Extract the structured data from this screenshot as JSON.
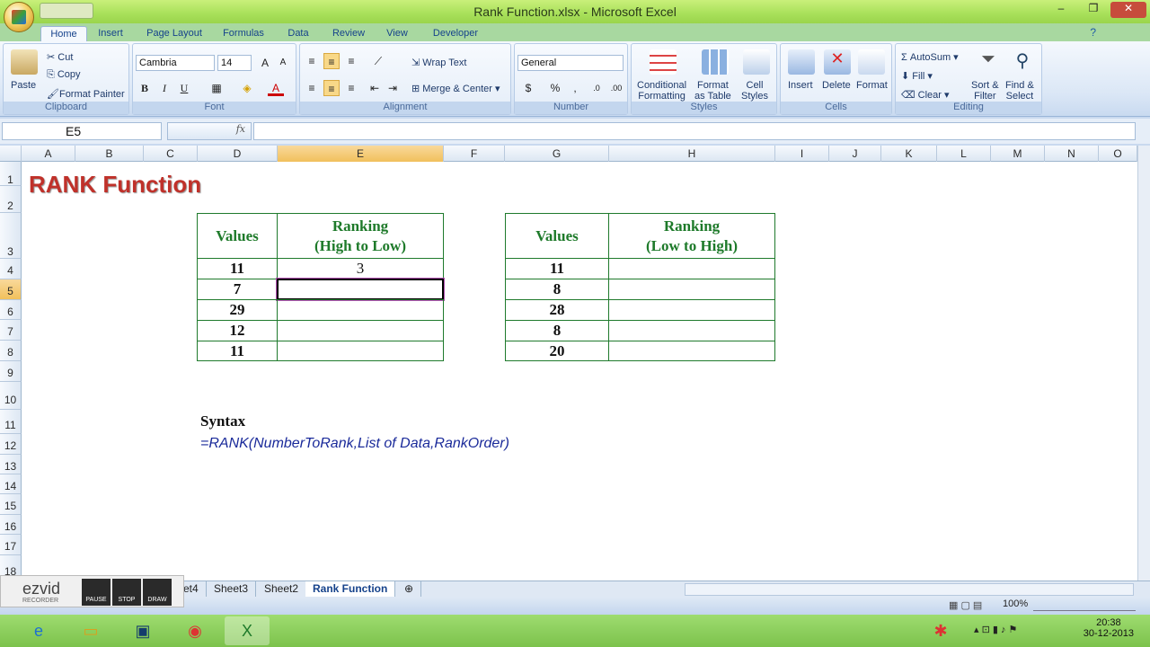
{
  "window": {
    "title": "Rank Function.xlsx - Microsoft Excel"
  },
  "tabs": [
    "Home",
    "Insert",
    "Page Layout",
    "Formulas",
    "Data",
    "Review",
    "View",
    "Developer"
  ],
  "clipboard": {
    "paste": "Paste",
    "cut": "Cut",
    "copy": "Copy",
    "format_painter": "Format Painter",
    "label": "Clipboard"
  },
  "font": {
    "name": "Cambria",
    "size": "14",
    "label": "Font",
    "bold": "B",
    "italic": "I",
    "underline": "U"
  },
  "alignment": {
    "wrap": "Wrap Text",
    "merge": "Merge & Center",
    "label": "Alignment"
  },
  "number": {
    "format": "General",
    "label": "Number",
    "pct": "%",
    "comma": ","
  },
  "styles": {
    "cond": "Conditional",
    "cond2": "Formatting",
    "fmt_table": "Format",
    "fmt_table2": "as Table",
    "cell": "Cell",
    "cell2": "Styles",
    "label": "Styles"
  },
  "cells": {
    "insert": "Insert",
    "delete": "Delete",
    "format": "Format",
    "label": "Cells"
  },
  "editing": {
    "autosum": "AutoSum",
    "fill": "Fill",
    "clear": "Clear",
    "sort": "Sort &",
    "sort2": "Filter",
    "find": "Find &",
    "find2": "Select",
    "label": "Editing"
  },
  "formula_bar": {
    "name_box": "E5",
    "fx": "fx",
    "formula": ""
  },
  "columns": [
    "A",
    "B",
    "C",
    "D",
    "E",
    "F",
    "G",
    "H",
    "I",
    "J",
    "K",
    "L",
    "M",
    "N",
    "O"
  ],
  "rows": [
    "1",
    "2",
    "3",
    "4",
    "5",
    "6",
    "7",
    "8",
    "9",
    "10",
    "11",
    "12",
    "13",
    "14",
    "15",
    "16",
    "17",
    "18"
  ],
  "sheet_title": "RANK Function",
  "table1": {
    "h1": "Values",
    "h2a": "Ranking",
    "h2b": "(High to Low)",
    "values": [
      "11",
      "7",
      "29",
      "12",
      "11"
    ],
    "ranks": [
      "3",
      "",
      "",
      "",
      ""
    ]
  },
  "table2": {
    "h1": "Values",
    "h2a": "Ranking",
    "h2b": "(Low to High)",
    "values": [
      "11",
      "8",
      "28",
      "8",
      "20"
    ],
    "ranks": [
      "",
      "",
      "",
      "",
      ""
    ]
  },
  "syntax": {
    "label": "Syntax",
    "formula": "=RANK(NumberToRank,List of Data,RankOrder)"
  },
  "sheet_tabs": [
    "et4",
    "Sheet3",
    "Sheet2",
    "Rank Function"
  ],
  "status": {
    "zoom": "100%"
  },
  "ezvid": {
    "logo": "ezvid",
    "sub": "RECORDER",
    "pause": "PAUSE",
    "stop": "STOP",
    "draw": "DRAW"
  },
  "clock": {
    "time": "20:38",
    "date": "30-12-2013"
  }
}
